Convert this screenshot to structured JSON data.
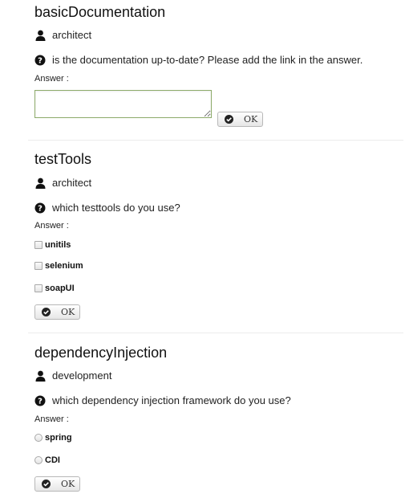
{
  "questions": [
    {
      "title": "basicDocumentation",
      "role": "architect",
      "question": "is the documentation up-to-date? Please add the link in the answer.",
      "answer_label": "Answer :",
      "answer_type": "textarea",
      "answer_value": "",
      "ok_label": "OK"
    },
    {
      "title": "testTools",
      "role": "architect",
      "question": "which testtools do you use?",
      "answer_label": "Answer :",
      "answer_type": "checkbox",
      "options": [
        "unitils",
        "selenium",
        "soapUI"
      ],
      "ok_label": "OK"
    },
    {
      "title": "dependencyInjection",
      "role": "development",
      "question": "which dependency injection framework do you use?",
      "answer_label": "Answer :",
      "answer_type": "radio",
      "options": [
        "spring",
        "CDI"
      ],
      "ok_label": "OK"
    }
  ],
  "icons": {
    "role": "user-icon",
    "question": "question-circle-icon",
    "ok": "check-circle-icon"
  },
  "colors": {
    "textarea_border": "#8dab6a",
    "divider": "#ececec"
  }
}
